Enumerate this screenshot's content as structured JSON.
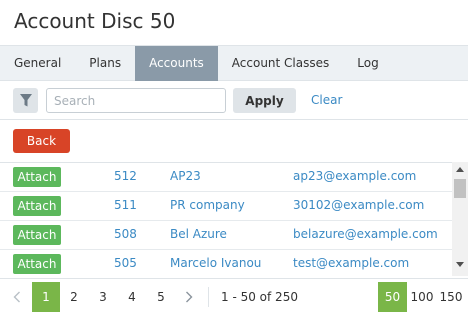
{
  "title": "Account Disc 50",
  "tabs": [
    {
      "label": "General"
    },
    {
      "label": "Plans"
    },
    {
      "label": "Accounts"
    },
    {
      "label": "Account Classes"
    },
    {
      "label": "Log"
    }
  ],
  "active_tab": "Accounts",
  "toolbar": {
    "search_placeholder": "Search",
    "search_value": "",
    "apply_label": "Apply",
    "clear_label": "Clear"
  },
  "back_label": "Back",
  "rows": [
    {
      "action": "Attach",
      "id": "512",
      "name": "AP23",
      "email": "ap23@example.com"
    },
    {
      "action": "Attach",
      "id": "511",
      "name": "PR company",
      "email": "30102@example.com"
    },
    {
      "action": "Attach",
      "id": "508",
      "name": "Bel Azure",
      "email": "belazure@example.com"
    },
    {
      "action": "Attach",
      "id": "505",
      "name": "Marcelo Ivanou",
      "email": "test@example.com"
    }
  ],
  "pagination": {
    "pages": [
      "1",
      "2",
      "3",
      "4",
      "5"
    ],
    "current_page": "1",
    "range_text": "1 - 50 of 250",
    "page_sizes": [
      "50",
      "100",
      "150"
    ],
    "current_page_size": "50"
  },
  "colors": {
    "active_tab": "#8a9aa8",
    "attach": "#5cb85c",
    "back": "#d84427",
    "link": "#3b8ac4",
    "active_page": "#7ab648"
  }
}
